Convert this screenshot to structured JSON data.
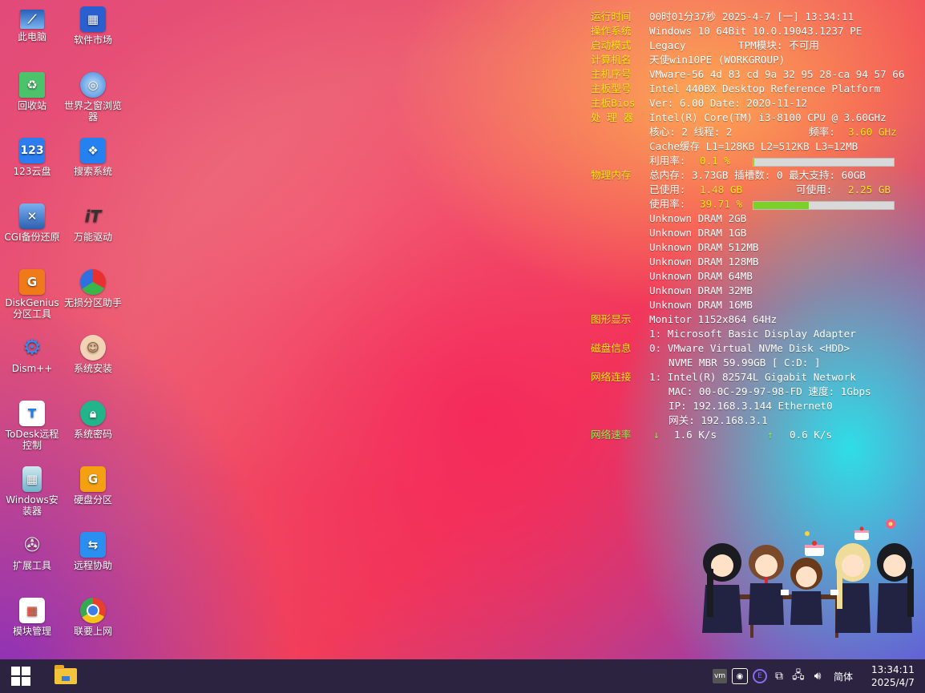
{
  "desktop": {
    "icons_left": [
      {
        "label": "此电脑"
      },
      {
        "label": "回收站"
      },
      {
        "label": "123云盘"
      },
      {
        "label": "CGI备份还原"
      },
      {
        "label": "DiskGenius分区工具"
      },
      {
        "label": "Dism++"
      },
      {
        "label": "ToDesk远程控制"
      },
      {
        "label": "Windows安装器"
      },
      {
        "label": "扩展工具"
      },
      {
        "label": "模块管理"
      }
    ],
    "icons_right": [
      {
        "label": "软件市场"
      },
      {
        "label": "世界之窗浏览器"
      },
      {
        "label": "搜索系统"
      },
      {
        "label": "万能驱动"
      },
      {
        "label": "无损分区助手"
      },
      {
        "label": "系统安装"
      },
      {
        "label": "系统密码"
      },
      {
        "label": "硬盘分区"
      },
      {
        "label": "远程协助"
      },
      {
        "label": "联要上网"
      }
    ]
  },
  "sysinfo": {
    "uptime": {
      "label": "运行时间",
      "value": "00时01分37秒 2025-4-7 [一] 13:34:11"
    },
    "os": {
      "label": "操作系统",
      "value": "Windows 10 64Bit 10.0.19043.1237 PE"
    },
    "boot": {
      "label": "启动模式",
      "value": "Legacy",
      "tpm": "TPM模块: 不可用"
    },
    "hostname": {
      "label": "计算机名",
      "value": "天使win10PE (WORKGROUP)"
    },
    "serial": {
      "label": "主机序号",
      "value": "VMware-56 4d 83 cd 9a 32 95 28-ca 94 57 66"
    },
    "board": {
      "label": "主板型号",
      "value": "Intel 440BX Desktop Reference Platform"
    },
    "bios": {
      "label": "主板Bios",
      "value": "Ver: 6.00 Date: 2020-11-12"
    },
    "cpu": {
      "label": "处 理 器",
      "model": "Intel(R) Core(TM) i3-8100 CPU @ 3.60GHz",
      "cores_threads": "核心: 2  线程: 2",
      "freq_label": "频率:",
      "freq_value": "3.60 GHz",
      "cache": "Cache缓存 L1=128KB  L2=512KB  L3=12MB",
      "usage_label": "利用率:",
      "usage_value": "0.1 %",
      "usage_fraction": 0.001
    },
    "memory": {
      "label": "物理内存",
      "total": "总内存: 3.73GB  插槽数: 0  最大支持: 60GB",
      "used_label": "已使用:",
      "used_value": "1.48 GB",
      "avail_label": "可使用:",
      "avail_value": "2.25 GB",
      "usage_label": "使用率:",
      "usage_value": "39.71 %",
      "usage_fraction": 0.3971,
      "modules": [
        "Unknown  DRAM 2GB",
        "Unknown  DRAM 1GB",
        "Unknown  DRAM 512MB",
        "Unknown  DRAM 128MB",
        "Unknown  DRAM 64MB",
        "Unknown  DRAM 32MB",
        "Unknown  DRAM 16MB"
      ]
    },
    "display": {
      "label": "图形显示",
      "monitor": "Monitor 1152x864 64Hz",
      "adapter": "1: Microsoft Basic Display Adapter"
    },
    "disk": {
      "label": "磁盘信息",
      "disk": "0: VMware Virtual NVMe Disk <HDD>",
      "detail": "NVME MBR 59.99GB [ C:D: ]"
    },
    "network": {
      "label": "网络连接",
      "adapter": "1: Intel(R) 82574L Gigabit Network",
      "mac": "MAC: 00-0C-29-97-98-FD 速度: 1Gbps",
      "ip": "IP:  192.168.3.144 Ethernet0",
      "gateway": "网关: 192.168.3.1"
    },
    "speed": {
      "label": "网络速率",
      "down_arrow": "↓",
      "down": "1.6 K/s",
      "up_arrow": "↑",
      "up": "0.6 K/s"
    }
  },
  "taskbar": {
    "lang": "简体",
    "time": "13:34:11",
    "date": "2025/4/7",
    "tray_icons": [
      "vmware-icon",
      "network-monitor-icon",
      "app-circle-icon",
      "copy-icon",
      "network-icon",
      "volume-icon"
    ]
  }
}
